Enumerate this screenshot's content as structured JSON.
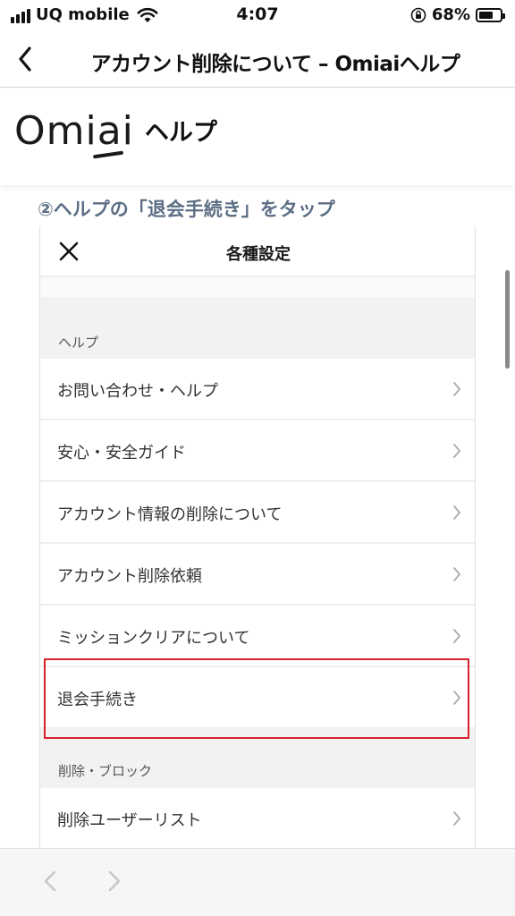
{
  "status_bar": {
    "carrier": "UQ mobile",
    "time": "4:07",
    "battery_percent": "68%",
    "battery_level": 0.68
  },
  "nav": {
    "title": "アカウント削除について – Omiaiヘルプ"
  },
  "help_header": {
    "logo_text": "Omiai",
    "help_label": "ヘルプ"
  },
  "step_heading": "②ヘルプの「退会手続き」をタップ",
  "embedded": {
    "title": "各種設定",
    "sections": [
      {
        "label": "ヘルプ",
        "items": [
          {
            "label": "お問い合わせ・ヘルプ"
          },
          {
            "label": "安心・安全ガイド"
          },
          {
            "label": "アカウント情報の削除について"
          },
          {
            "label": "アカウント削除依頼"
          },
          {
            "label": "ミッションクリアについて"
          },
          {
            "label": "退会手続き",
            "highlighted": true
          }
        ]
      },
      {
        "label": "削除・ブロック",
        "items": [
          {
            "label": "削除ユーザーリスト"
          }
        ]
      }
    ]
  },
  "colors": {
    "highlight": "#d9212f",
    "step_heading": "#5d6f85"
  },
  "icons": [
    "wifi-icon",
    "rotation-lock-icon",
    "battery-icon",
    "back-chevron-icon",
    "close-icon",
    "chevron-right-icon"
  ]
}
